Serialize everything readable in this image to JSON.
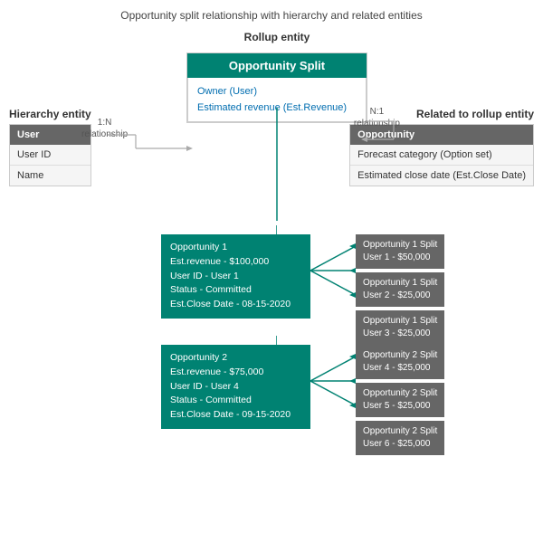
{
  "page": {
    "title": "Opportunity split relationship with hierarchy and related entities"
  },
  "rollup": {
    "label": "Rollup entity",
    "header": "Opportunity Split",
    "fields": [
      "Owner (User)",
      "Estimated revenue (Est.Revenue)"
    ]
  },
  "hierarchy": {
    "title": "Hierarchy entity",
    "header": "User",
    "fields": [
      "User ID",
      "Name"
    ]
  },
  "related": {
    "title": "Related to rollup entity",
    "header": "Opportunity",
    "fields": [
      "Forecast category (Option set)",
      "Estimated close date (Est.Close Date)"
    ]
  },
  "rel_left": {
    "line1": "1:N",
    "line2": "relationship"
  },
  "rel_right": {
    "line1": "N:1",
    "line2": "relationship"
  },
  "opportunities": [
    {
      "lines": [
        "Opportunity 1",
        "Est.revenue - $100,000",
        "User ID - User 1",
        "Status - Committed",
        "Est.Close Date - 08-15-2020"
      ],
      "splits": [
        [
          "Opportunity 1 Split",
          "User 1 - $50,000"
        ],
        [
          "Opportunity 1 Split",
          "User 2 - $25,000"
        ],
        [
          "Opportunity 1 Split",
          "User 3 - $25,000"
        ]
      ]
    },
    {
      "lines": [
        "Opportunity 2",
        "Est.revenue - $75,000",
        "User ID - User 4",
        "Status - Committed",
        "Est.Close Date - 09-15-2020"
      ],
      "splits": [
        [
          "Opportunity 2 Split",
          "User 4 - $25,000"
        ],
        [
          "Opportunity 2 Split",
          "User 5 - $25,000"
        ],
        [
          "Opportunity 2 Split",
          "User 6 - $25,000"
        ]
      ]
    }
  ]
}
